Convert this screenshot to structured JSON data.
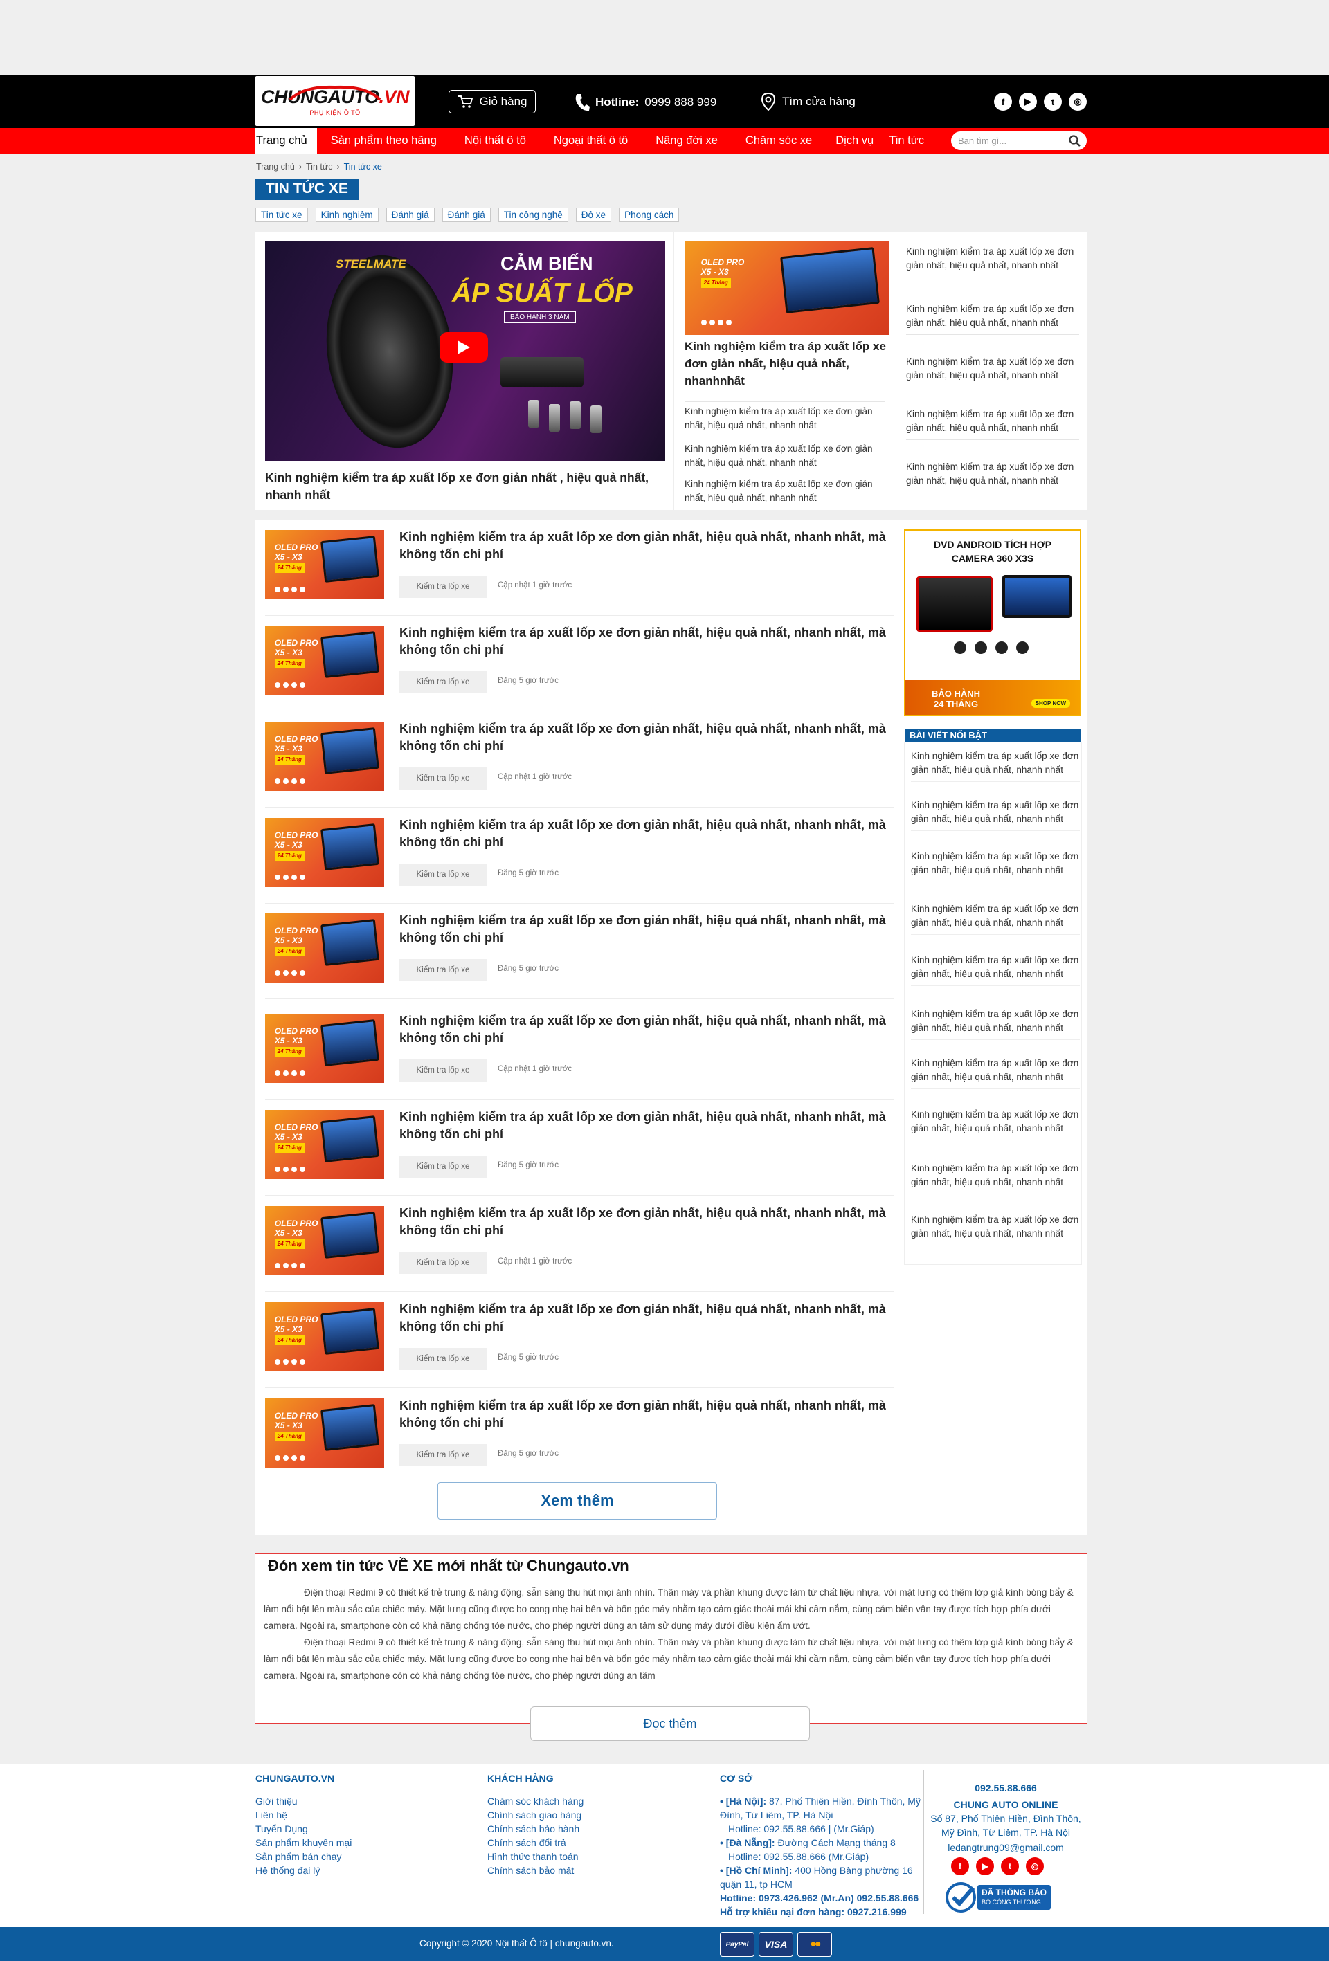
{
  "header": {
    "logo_main": "CHUNGAUTO",
    "logo_tld": ".VN",
    "logo_sub": "PHỤ KIỆN Ô TÔ",
    "cart_label": "Giỏ hàng",
    "hotline_label": "Hotline:",
    "hotline_number": "0999 888 999",
    "store_label": "Tìm cửa hàng",
    "socials": [
      "f",
      "▶",
      "t",
      "◎"
    ]
  },
  "nav": {
    "items": [
      "Trang chủ",
      "Sản phẩm theo hãng",
      "Nội thất ô tô",
      "Ngoại thất ô tô",
      "Nâng đời xe",
      "Chăm sóc xe",
      "Dịch vụ",
      "Tin tức"
    ],
    "search_placeholder": "Bạn tìm gì..."
  },
  "breadcrumb": [
    "Trang chủ",
    "Tin tức",
    "Tin tức xe"
  ],
  "page_title": "TIN TỨC XE",
  "categories": [
    "Tin tức xe",
    "Kinh nghiệm",
    "Đánh giá",
    "Đánh giá",
    "Tin công nghệ",
    "Độ xe",
    "Phong cách"
  ],
  "featured": {
    "banner_brand": "STEELMATE",
    "banner_line1": "CẢM BIẾN",
    "banner_line2": "ÁP SUẤT LỐP",
    "banner_warranty": "BẢO HÀNH 3 NĂM",
    "main_title": "Kinh nghiệm kiểm tra áp xuất lốp xe đơn giản nhất , hiệu quả nhất, nhanh nhất",
    "mid_title": "Kinh nghiệm kiểm tra áp xuất lốp xe đơn giản nhất, hiệu quả nhất, nhanhnhất",
    "mid_links": [
      "Kinh nghiệm kiểm tra áp xuất lốp xe đơn giản nhất, hiệu quả nhất, nhanh nhất",
      "Kinh nghiệm kiểm tra áp xuất lốp xe đơn giản nhất, hiệu quả nhất, nhanh nhất",
      "Kinh nghiệm kiểm tra áp xuất lốp xe đơn giản nhất, hiệu quả nhất, nhanh nhất"
    ],
    "right_links": [
      "Kinh nghiệm kiểm tra áp xuất lốp xe đơn giản nhất, hiệu quả nhất, nhanh nhất",
      "Kinh nghiệm kiểm tra áp xuất lốp xe đơn giản nhất, hiệu quả nhất, nhanh nhất",
      "Kinh nghiệm kiểm tra áp xuất lốp xe đơn giản nhất, hiệu quả nhất, nhanh nhất",
      "Kinh nghiệm kiểm tra áp xuất lốp xe đơn giản nhất, hiệu quả nhất, nhanh nhất",
      "Kinh nghiệm kiểm tra áp xuất lốp xe đơn giản nhất, hiệu quả nhất, nhanh nhất"
    ]
  },
  "product_thumb": {
    "line1": "OLED PRO",
    "line2": "X5 - X3",
    "line3": "24 Tháng"
  },
  "articles": [
    {
      "title": "Kinh nghiệm kiểm tra áp xuất lốp xe đơn giản nhất, hiệu quả nhất, nhanh nhất, mà không tốn chi phí",
      "tag": "Kiểm tra lốp xe",
      "time": "Cập nhật 1 giờ trước"
    },
    {
      "title": "Kinh nghiệm kiểm tra áp xuất lốp xe đơn giản nhất, hiệu quả nhất, nhanh nhất, mà không tốn chi phí",
      "tag": "Kiểm tra lốp xe",
      "time": "Đăng 5 giờ trước"
    },
    {
      "title": "Kinh nghiệm kiểm tra áp xuất lốp xe đơn giản nhất, hiệu quả nhất, nhanh nhất, mà không tốn chi phí",
      "tag": "Kiểm tra lốp xe",
      "time": "Cập nhật 1 giờ trước"
    },
    {
      "title": "Kinh nghiệm kiểm tra áp xuất lốp xe đơn giản nhất, hiệu quả nhất, nhanh nhất, mà không tốn chi phí",
      "tag": "Kiểm tra lốp xe",
      "time": "Đăng 5 giờ trước"
    },
    {
      "title": "Kinh nghiệm kiểm tra áp xuất lốp xe đơn giản nhất, hiệu quả nhất, nhanh nhất, mà không tốn chi phí",
      "tag": "Kiểm tra lốp xe",
      "time": "Đăng 5 giờ trước"
    },
    {
      "title": "Kinh nghiệm kiểm tra áp xuất lốp xe đơn giản nhất, hiệu quả nhất, nhanh nhất, mà không tốn chi phí",
      "tag": "Kiểm tra lốp xe",
      "time": "Cập nhật 1 giờ trước"
    },
    {
      "title": "Kinh nghiệm kiểm tra áp xuất lốp xe đơn giản nhất, hiệu quả nhất, nhanh nhất, mà không tốn chi phí",
      "tag": "Kiểm tra lốp xe",
      "time": "Đăng 5 giờ trước"
    },
    {
      "title": "Kinh nghiệm kiểm tra áp xuất lốp xe đơn giản nhất, hiệu quả nhất, nhanh nhất, mà không tốn chi phí",
      "tag": "Kiểm tra lốp xe",
      "time": "Cập nhật 1 giờ trước"
    },
    {
      "title": "Kinh nghiệm kiểm tra áp xuất lốp xe đơn giản nhất, hiệu quả nhất, nhanh nhất, mà không tốn chi phí",
      "tag": "Kiểm tra lốp xe",
      "time": "Đăng 5 giờ trước"
    },
    {
      "title": "Kinh nghiệm kiểm tra áp xuất lốp xe đơn giản nhất, hiệu quả nhất, nhanh nhất, mà không tốn chi phí",
      "tag": "Kiểm tra lốp xe",
      "time": "Đăng 5 giờ trước"
    }
  ],
  "more_label": "Xem thêm",
  "sidebar": {
    "ad_line1": "DVD ANDROID TÍCH HỢP",
    "ad_line2": "CAMERA 360 X3S",
    "ad_warranty_1": "BẢO HÀNH",
    "ad_warranty_2": "24 THÁNG",
    "ad_shop": "SHOP NOW",
    "heading": "BÀI VIẾT NỔI BẬT",
    "links": [
      "Kinh nghiệm kiểm tra áp xuất lốp xe đơn giản nhất, hiệu quả nhất, nhanh nhất",
      "Kinh nghiệm kiểm tra áp xuất lốp xe đơn giản nhất, hiệu quả nhất, nhanh nhất",
      "Kinh nghiệm kiểm tra áp xuất lốp xe đơn giản nhất, hiệu quả nhất, nhanh nhất",
      "Kinh nghiệm kiểm tra áp xuất lốp xe đơn giản nhất, hiệu quả nhất, nhanh nhất",
      "Kinh nghiệm kiểm tra áp xuất lốp xe đơn giản nhất, hiệu quả nhất, nhanh nhất",
      "Kinh nghiệm kiểm tra áp xuất lốp xe đơn giản nhất, hiệu quả nhất, nhanh nhất",
      "Kinh nghiệm kiểm tra áp xuất lốp xe đơn giản nhất, hiệu quả nhất, nhanh nhất",
      "Kinh nghiệm kiểm tra áp xuất lốp xe đơn giản nhất, hiệu quả nhất, nhanh nhất",
      "Kinh nghiệm kiểm tra áp xuất lốp xe đơn giản nhất, hiệu quả nhất, nhanh nhất",
      "Kinh nghiệm kiểm tra áp xuất lốp xe đơn giản nhất, hiệu quả nhất, nhanh nhất"
    ]
  },
  "seo": {
    "title": "Đón xem tin tức VỀ XE mới nhất từ Chungauto.vn",
    "p1": "Điện thoại Redmi 9 có thiết kế trẻ trung & năng động, sẵn sàng thu hút mọi ánh nhìn. Thân máy và phần khung được làm từ chất liệu nhựa, với mặt lưng có thêm lớp giả kính bóng bẩy & làm nổi bật lên màu sắc của chiếc máy. Mặt lưng cũng được bo cong nhẹ hai bên và bốn góc máy nhằm tạo cảm giác thoải mái khi cầm nắm, cùng cảm biến vân tay được tích hợp phía dưới camera. Ngoài ra, smartphone còn có khả năng chống tóe nước, cho phép người dùng an tâm sử dụng máy dưới điều kiện ẩm ướt.",
    "p2": "Điện thoại Redmi 9 có thiết kế trẻ trung & năng động, sẵn sàng thu hút mọi ánh nhìn. Thân máy và phần khung được làm từ chất liệu nhựa, với mặt lưng có thêm lớp giả kính bóng bẩy & làm nổi bật lên màu sắc của chiếc máy. Mặt lưng cũng được bo cong nhẹ hai bên và bốn góc máy nhằm tạo cảm giác thoải mái khi cầm nắm, cùng cảm biến vân tay được tích hợp phía dưới camera. Ngoài ra, smartphone còn có khả năng chống tóe nước, cho phép người dùng an tâm",
    "read_more": "Đọc thêm"
  },
  "footer": {
    "col1_title": "CHUNGAUTO.VN",
    "col1_links": [
      "Giới thiệu",
      "Liên hệ",
      "Tuyển Dụng",
      "Sản phẩm khuyến mại",
      "Sản phẩm bán chạy",
      "Hệ thống đại lý"
    ],
    "col2_title": "KHÁCH HÀNG",
    "col2_links": [
      "Chăm sóc khách hàng",
      "Chính sách giao hàng",
      "Chính sách bảo hành",
      "Chính sách đổi trả",
      "Hình thức thanh toán",
      "Chính sách bảo mật"
    ],
    "col3_title": "CƠ SỞ",
    "hn_label": "• [Hà Nội]:",
    "hn_addr": "87, Phố Thiên Hiền, Đình Thôn, Mỹ Đình, Từ Liêm, TP. Hà Nội",
    "hn_hotline": "Hotline: 092.55.88.666 | (Mr.Giáp)",
    "dn_label": "• [Đà Nẵng]:",
    "dn_addr": "Đường Cách Mạng tháng 8",
    "dn_hotline": "Hotline: 092.55.88.666 (Mr.Giáp)",
    "hcm_label": "• [Hồ Chí Minh]:",
    "hcm_addr": "400 Hồng Bàng phường 16 quận 11, tp HCM",
    "hotline_all": "Hotline: 0973.426.962 (Mr.An) 092.55.88.666",
    "complaint": "Hỗ trợ khiếu nại đơn hàng: 0927.216.999",
    "col4_phone": "092.55.88.666",
    "col4_name": "CHUNG AUTO ONLINE",
    "col4_addr": "Số 87, Phố Thiên Hiền, Đình Thôn, Mỹ Đình, Từ Liêm, TP. Hà Nội",
    "col4_email": "ledangtrung09@gmail.com",
    "badge_line1": "ĐÃ THÔNG BÁO",
    "badge_line2": "BỘ CÔNG THƯƠNG",
    "copyright": "Copyright © 2020 Nội thất Ô tô | chungauto.vn.",
    "payments": [
      "PayPal",
      "VISA",
      "●●"
    ]
  },
  "colors": {
    "brand_blue": "#0d5c9e",
    "nav_red": "#ff0000",
    "header_black": "#000000"
  }
}
